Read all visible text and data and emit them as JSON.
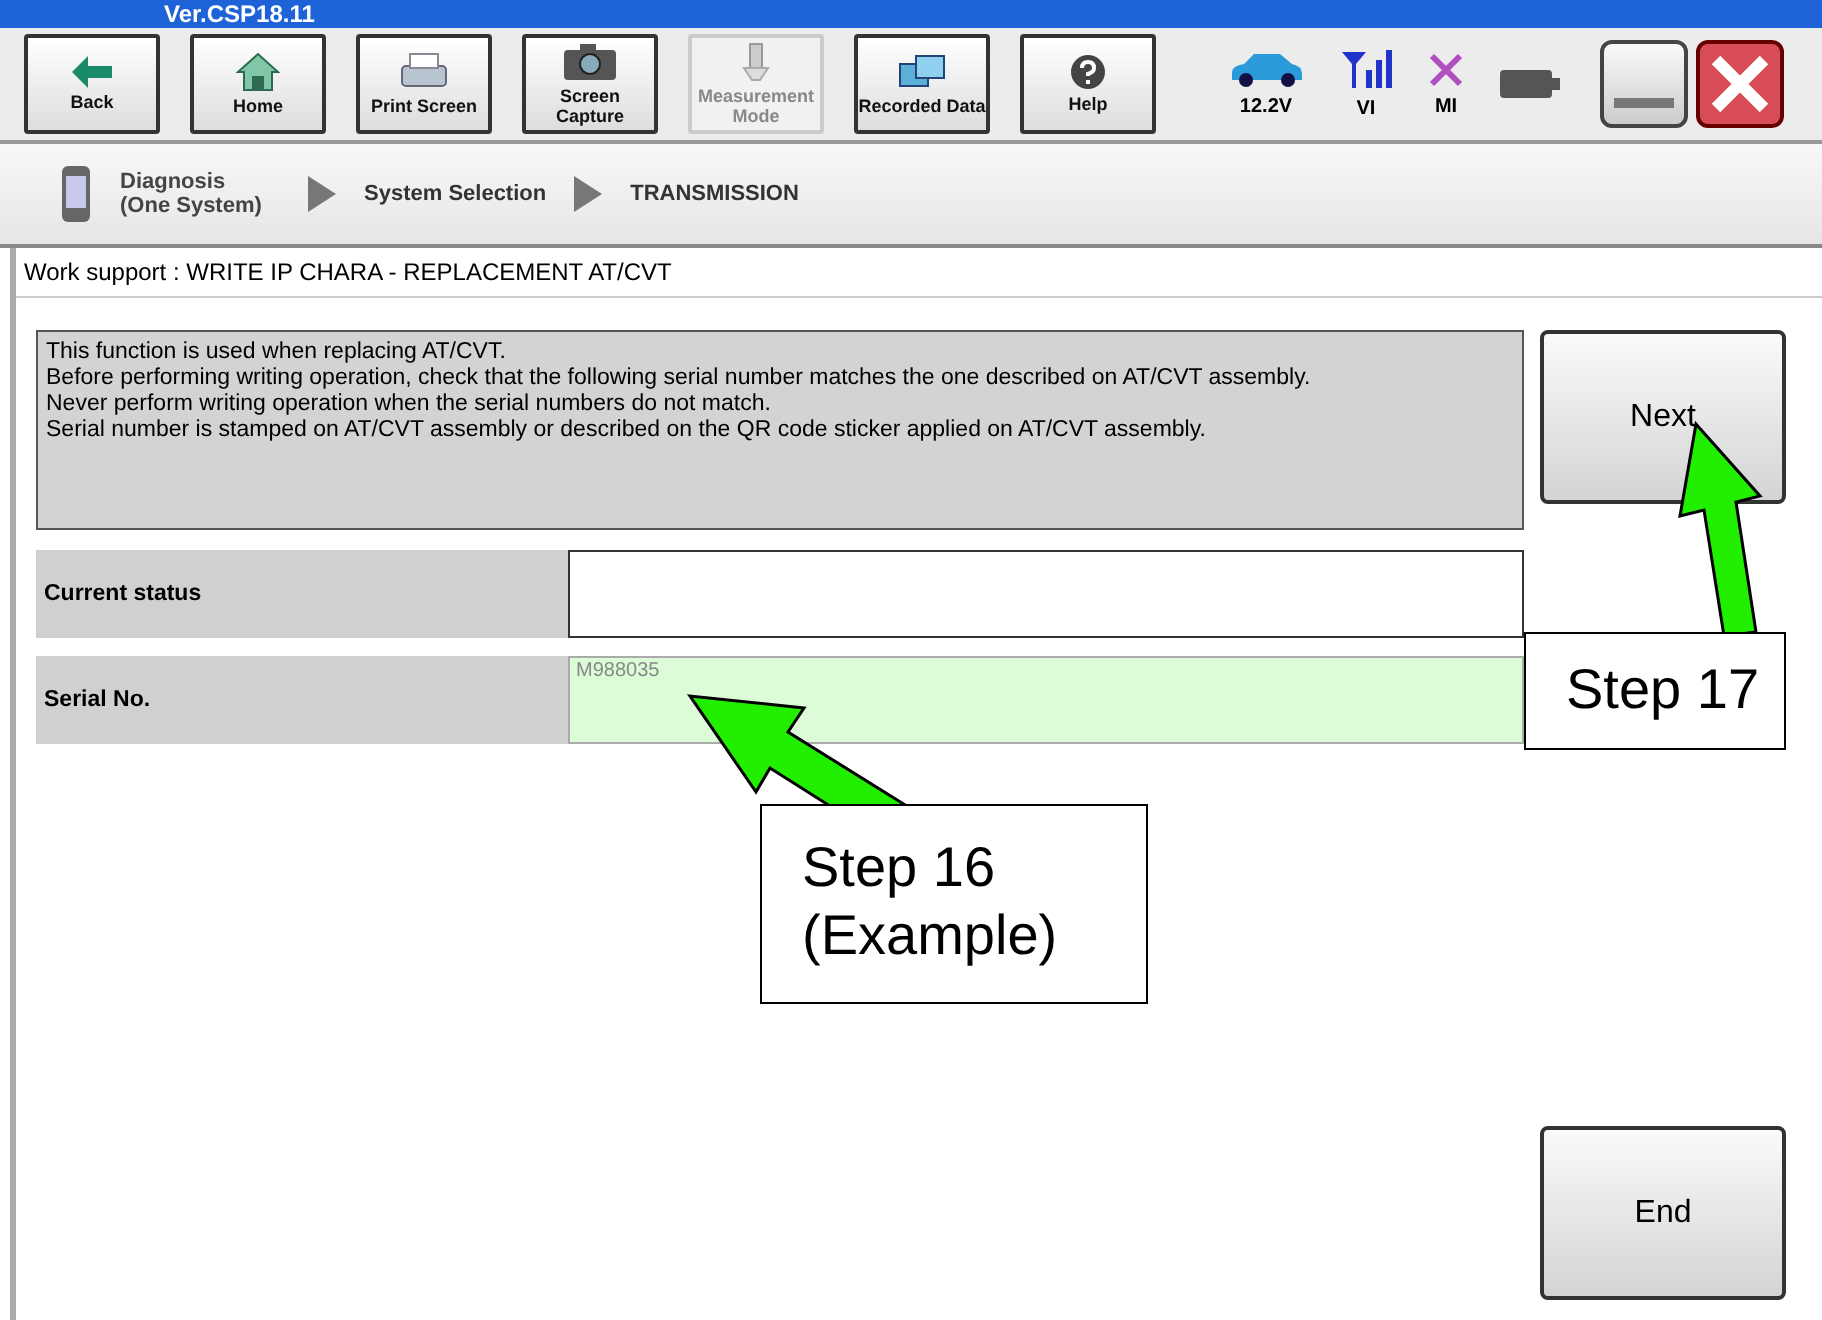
{
  "title_bar": {
    "version": "Ver.CSP18.11"
  },
  "toolbar": {
    "buttons": [
      {
        "label": "Back",
        "kind": "back",
        "disabled": false
      },
      {
        "label": "Home",
        "kind": "home",
        "disabled": false
      },
      {
        "label": "Print Screen",
        "kind": "print",
        "disabled": false
      },
      {
        "label": "Screen Capture",
        "kind": "camera",
        "disabled": false
      },
      {
        "label": "Measurement Mode",
        "kind": "meter",
        "disabled": true
      },
      {
        "label": "Recorded Data",
        "kind": "data",
        "disabled": false
      },
      {
        "label": "Help",
        "kind": "help",
        "disabled": false
      }
    ],
    "indicators": [
      {
        "label": "12.2V",
        "kind": "car"
      },
      {
        "label": "VI",
        "kind": "signal"
      },
      {
        "label": "MI",
        "kind": "cross"
      },
      {
        "kind": "battery"
      }
    ]
  },
  "breadcrumb": [
    {
      "label": "Diagnosis (One System)"
    },
    {
      "label": "System Selection"
    },
    {
      "label": "TRANSMISSION"
    }
  ],
  "heading": "Work support : WRITE IP CHARA - REPLACEMENT AT/CVT",
  "info_lines": [
    "This function is used when replacing AT/CVT.",
    "Before performing writing operation, check that the following serial number matches the one described on AT/CVT  assembly.",
    "Never perform writing operation when the serial numbers do not match.",
    "Serial number is stamped on AT/CVT assembly or described on the QR code sticker applied on AT/CVT assembly."
  ],
  "next_button": "Next",
  "fields": [
    {
      "label": "Current status",
      "kind": "plain"
    },
    {
      "label": "Serial No.",
      "value": "M988035",
      "kind": "highlight"
    }
  ],
  "end_button": "End",
  "callouts": [
    {
      "text": "Step 17",
      "kind": "next"
    },
    {
      "text": "Step 16\n(Example)",
      "kind": "serial"
    }
  ]
}
